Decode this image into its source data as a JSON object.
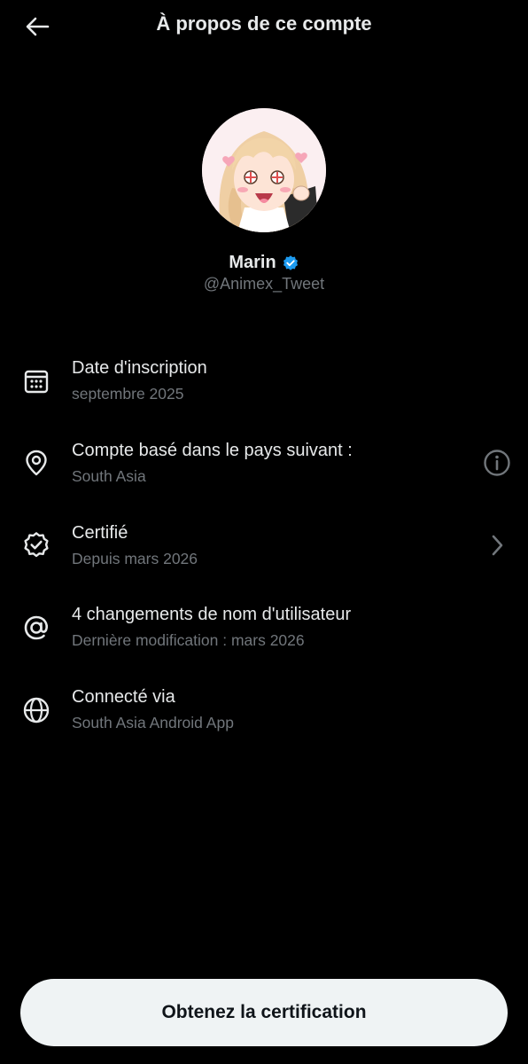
{
  "header": {
    "title": "À propos de ce compte",
    "back_icon": "arrow-left-icon"
  },
  "profile": {
    "name": "Marin",
    "handle": "@Animex_Tweet",
    "verified_icon": "verified-badge-icon",
    "verified_color": "#1d9bf0"
  },
  "rows": [
    {
      "icon": "calendar-icon",
      "title": "Date d'inscription",
      "subtitle": "septembre 2025"
    },
    {
      "icon": "location-pin-icon",
      "title": "Compte basé dans le pays suivant :",
      "subtitle": "South Asia",
      "trailing_icon": "info-icon"
    },
    {
      "icon": "verified-outline-icon",
      "title": "Certifié",
      "subtitle": "Depuis mars 2026",
      "trailing_icon": "chevron-right-icon"
    },
    {
      "icon": "at-sign-icon",
      "title": "4 changements de nom d'utilisateur",
      "subtitle": "Dernière modification : mars 2026"
    },
    {
      "icon": "globe-icon",
      "title": "Connecté via",
      "subtitle": "South Asia Android App"
    }
  ],
  "cta": {
    "label": "Obtenez la certification"
  },
  "colors": {
    "background": "#000000",
    "text_primary": "#e7e9ea",
    "text_secondary": "#71767b",
    "accent": "#1d9bf0",
    "button_bg": "#eff3f4"
  }
}
